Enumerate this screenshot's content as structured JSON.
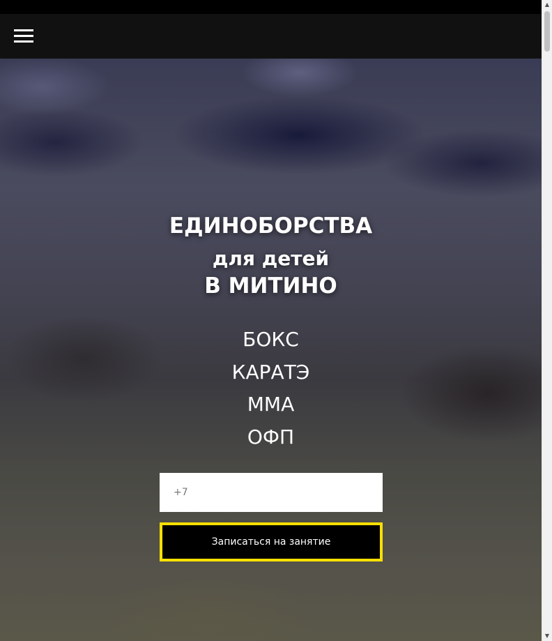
{
  "hero": {
    "title_line1": "ЕДИНОБОРСТВА",
    "title_line2": "для детей",
    "title_line3": "В МИТИНО"
  },
  "sports": [
    "БОКС",
    "КАРАТЭ",
    "ММА",
    "ОФП"
  ],
  "form": {
    "phone_placeholder": "+7",
    "submit_label": "Записаться на занятие"
  },
  "icons": {
    "menu": "hamburger-menu-icon",
    "scroll_up": "triangle-up",
    "scroll_down": "triangle-down"
  },
  "colors": {
    "header_bg": "#111111",
    "button_bg": "#000000",
    "button_border": "#ffe000",
    "text": "#ffffff"
  }
}
